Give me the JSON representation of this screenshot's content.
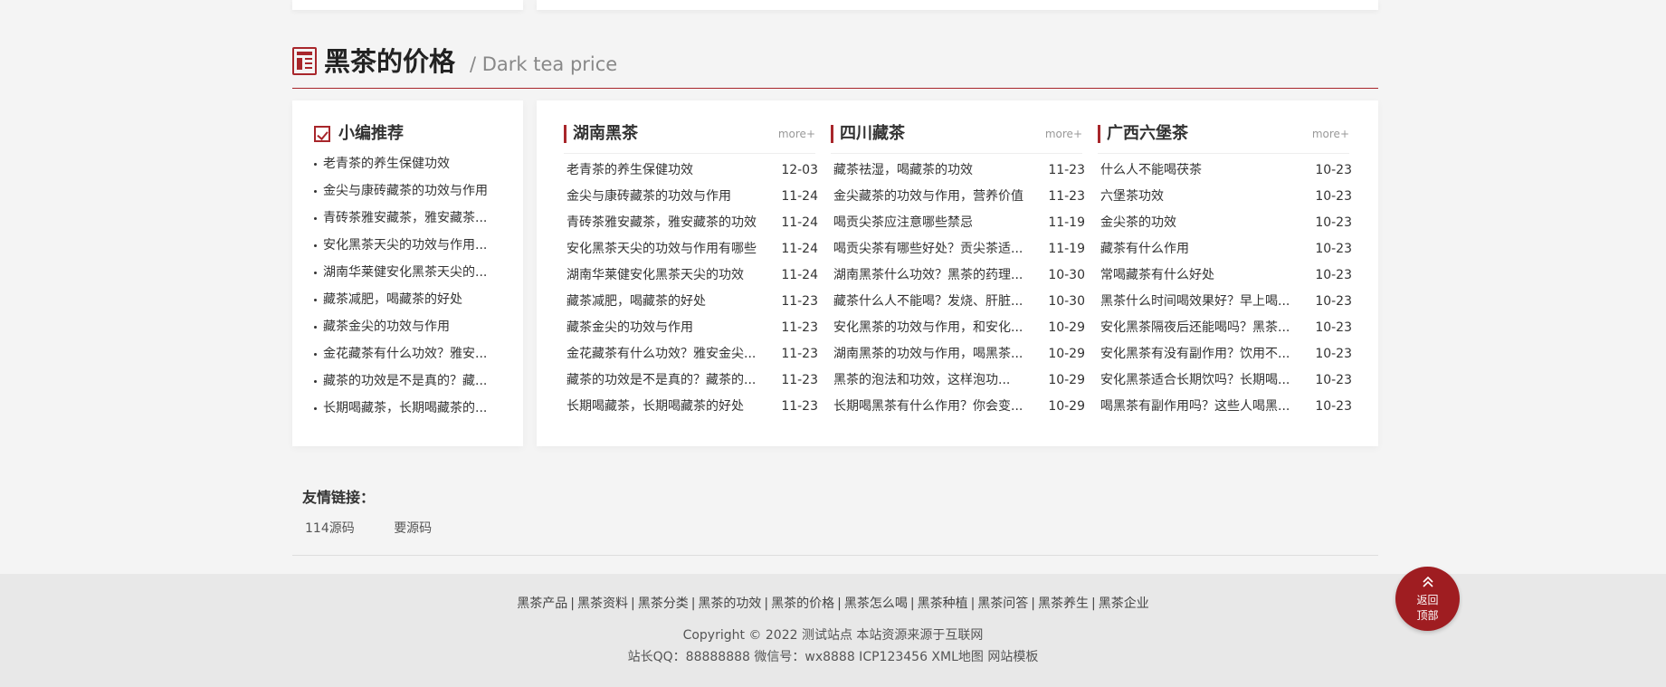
{
  "section": {
    "title": "黑茶的价格",
    "subtitle": "/ Dark tea price"
  },
  "recommend": {
    "title": "小编推荐",
    "items": [
      "老青茶的养生保健功效",
      "金尖与康砖藏茶的功效与作用",
      "青砖茶雅安藏茶，雅安藏茶...",
      "安化黑茶天尖的功效与作用...",
      "湖南华莱健安化黑茶天尖的...",
      "藏茶减肥，喝藏茶的好处",
      "藏茶金尖的功效与作用",
      "金花藏茶有什么功效？雅安...",
      "藏茶的功效是不是真的？藏...",
      "长期喝藏茶，长期喝藏茶的..."
    ]
  },
  "columns": [
    {
      "title": "湖南黑茶",
      "more": "more+",
      "items": [
        {
          "title": "老青茶的养生保健功效",
          "date": "12-03"
        },
        {
          "title": "金尖与康砖藏茶的功效与作用",
          "date": "11-24"
        },
        {
          "title": "青砖茶雅安藏茶，雅安藏茶的功效",
          "date": "11-24"
        },
        {
          "title": "安化黑茶天尖的功效与作用有哪些",
          "date": "11-24"
        },
        {
          "title": "湖南华莱健安化黑茶天尖的功效",
          "date": "11-24"
        },
        {
          "title": "藏茶减肥，喝藏茶的好处",
          "date": "11-23"
        },
        {
          "title": "藏茶金尖的功效与作用",
          "date": "11-23"
        },
        {
          "title": "金花藏茶有什么功效？雅安金尖...",
          "date": "11-23"
        },
        {
          "title": "藏茶的功效是不是真的？藏茶的...",
          "date": "11-23"
        },
        {
          "title": "长期喝藏茶，长期喝藏茶的好处",
          "date": "11-23"
        }
      ]
    },
    {
      "title": "四川藏茶",
      "more": "more+",
      "items": [
        {
          "title": "藏茶祛湿，喝藏茶的功效",
          "date": "11-23"
        },
        {
          "title": "金尖藏茶的功效与作用，营养价值",
          "date": "11-23"
        },
        {
          "title": "喝贡尖茶应注意哪些禁忌",
          "date": "11-19"
        },
        {
          "title": "喝贡尖茶有哪些好处？贡尖茶适...",
          "date": "11-19"
        },
        {
          "title": "湖南黑茶什么功效？黑茶的药理...",
          "date": "10-30"
        },
        {
          "title": "藏茶什么人不能喝？发烧、肝脏...",
          "date": "10-30"
        },
        {
          "title": "安化黑茶的功效与作用，和安化...",
          "date": "10-29"
        },
        {
          "title": "湖南黑茶的功效与作用，喝黑茶...",
          "date": "10-29"
        },
        {
          "title": "黑茶的泡法和功效，这样泡功...",
          "date": "10-29"
        },
        {
          "title": "长期喝黑茶有什么作用？你会变...",
          "date": "10-29"
        }
      ]
    },
    {
      "title": "广西六堡茶",
      "more": "more+",
      "items": [
        {
          "title": "什么人不能喝茯茶",
          "date": "10-23"
        },
        {
          "title": "六堡茶功效",
          "date": "10-23"
        },
        {
          "title": "金尖茶的功效",
          "date": "10-23"
        },
        {
          "title": "藏茶有什么作用",
          "date": "10-23"
        },
        {
          "title": "常喝藏茶有什么好处",
          "date": "10-23"
        },
        {
          "title": "黑茶什么时间喝效果好？早上喝...",
          "date": "10-23"
        },
        {
          "title": "安化黑茶隔夜后还能喝吗？黑茶...",
          "date": "10-23"
        },
        {
          "title": "安化黑茶有没有副作用？饮用不...",
          "date": "10-23"
        },
        {
          "title": "安化黑茶适合长期饮吗？长期喝...",
          "date": "10-23"
        },
        {
          "title": "喝黑茶有副作用吗？这些人喝黑...",
          "date": "10-23"
        }
      ]
    }
  ],
  "friend_links": {
    "title": "友情链接：",
    "items": [
      "114源码",
      "要源码"
    ]
  },
  "footer": {
    "nav": [
      "黑茶产品",
      "黑茶资料",
      "黑茶分类",
      "黑茶的功效",
      "黑茶的价格",
      "黑茶怎么喝",
      "黑茶种植",
      "黑茶问答",
      "黑茶养生",
      "黑茶企业"
    ],
    "copyright": "Copyright © 2022 测试站点 本站资源来源于互联网",
    "beian": "站长QQ：88888888 微信号：wx8888 ICP123456 XML地图 网站模板"
  },
  "back_to_top": {
    "line1": "返回",
    "line2": "顶部",
    "icon": "double-chevron-up-icon"
  },
  "colors": {
    "accent": "#a8262b",
    "background": "#f4f4f4",
    "footer_bg": "#e8e8e8"
  }
}
